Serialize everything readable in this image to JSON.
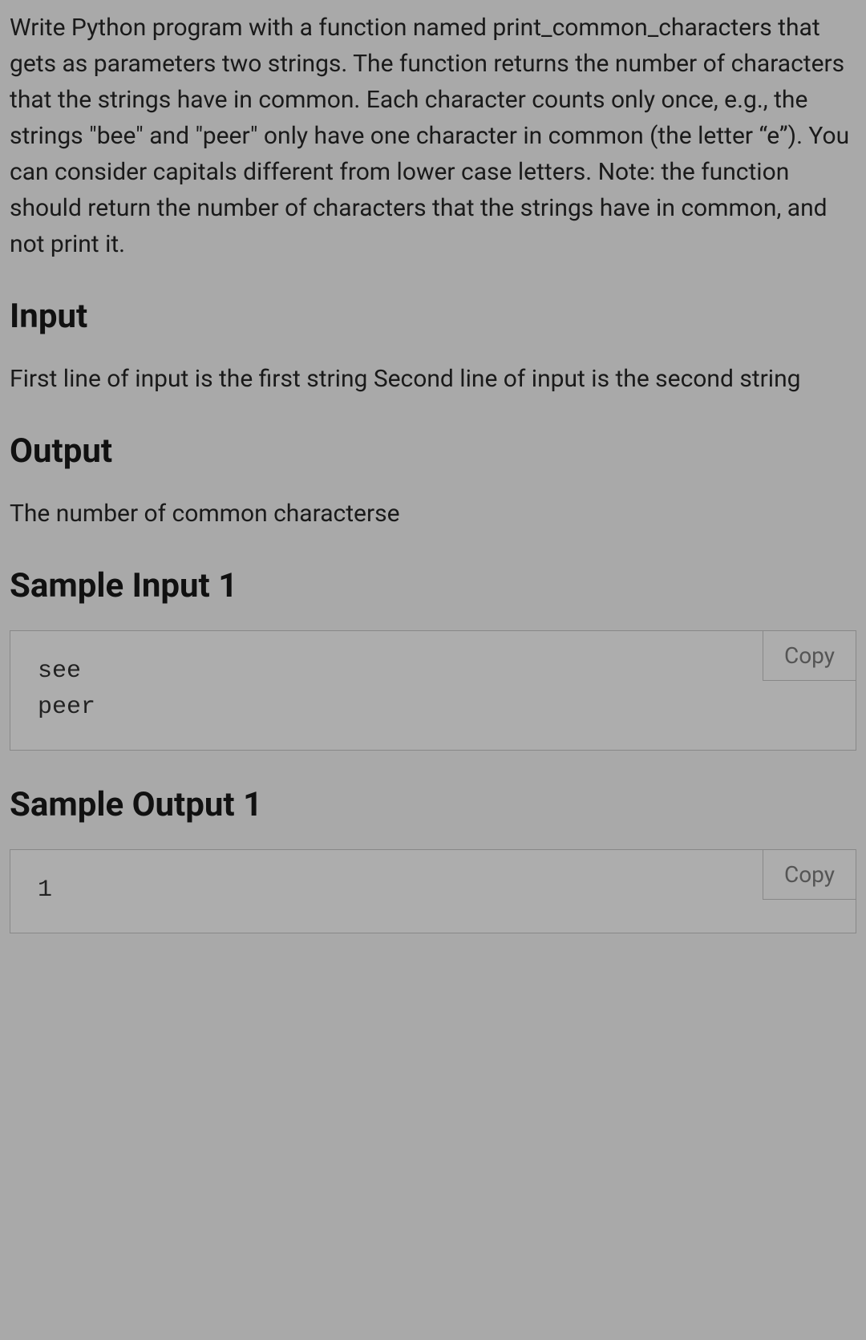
{
  "problem": {
    "description": "Write Python program with a function named print_common_characters that gets as parameters two strings. The function returns the number of characters that the strings have in common. Each character counts only once, e.g., the strings \"bee\" and \"peer\" only have one character in common (the letter “e”). You can consider capitals different from lower case letters. Note: the function should return the number of characters that the strings have in common, and not print it."
  },
  "input_section": {
    "heading": "Input",
    "text": "First line of input is the first string Second line of input is the second string"
  },
  "output_section": {
    "heading": "Output",
    "text": "The number of common characterse"
  },
  "sample_input_1": {
    "heading": "Sample Input 1",
    "content": "see\npeer",
    "copy_label": "Copy"
  },
  "sample_output_1": {
    "heading": "Sample Output 1",
    "content": "1",
    "copy_label": "Copy"
  }
}
